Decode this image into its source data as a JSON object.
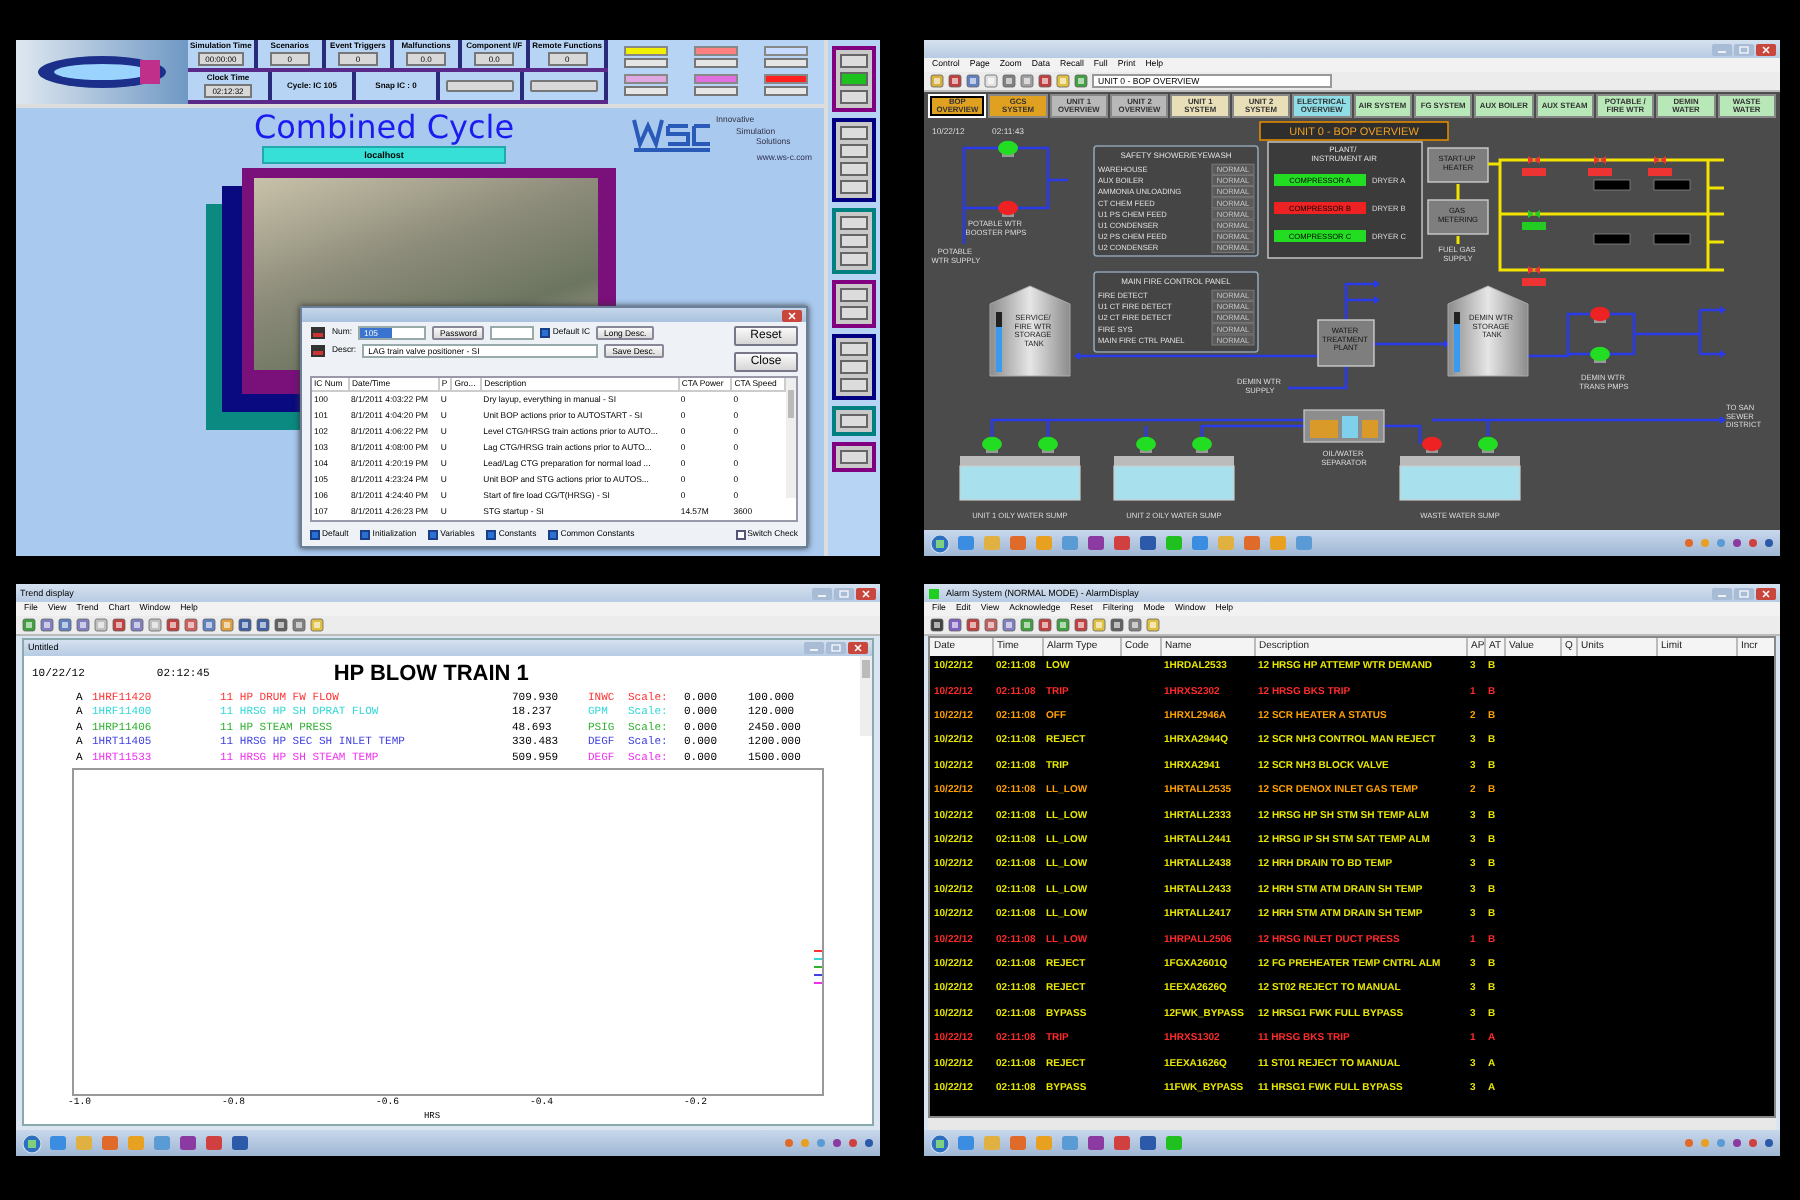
{
  "simulator": {
    "status_fields": [
      {
        "label": "Simulation Time",
        "value": "00:00:00"
      },
      {
        "label": "Scenarios",
        "value": "0"
      },
      {
        "label": "Event Triggers",
        "value": "0"
      },
      {
        "label": "Malfunctions",
        "value": "0.0"
      },
      {
        "label": "Component I/F",
        "value": "0.0"
      },
      {
        "label": "Remote Functions",
        "value": "0"
      }
    ],
    "info_fields": [
      {
        "label": "Clock Time",
        "value": "02:12:32"
      },
      {
        "label": "Cycle: IC 105"
      },
      {
        "label": "Snap IC : 0"
      }
    ],
    "alarm_tags": [
      {
        "color": "#f0f000"
      },
      {
        "color": "#ff8080"
      },
      {
        "color": "#c8dcff"
      },
      {
        "color": "#e0a8e0"
      },
      {
        "color": "#e070e0"
      },
      {
        "color": "#ff2020"
      }
    ],
    "title": "Combined Cycle",
    "server": "localhost",
    "brand_lines": [
      "Innovative",
      "Simulation",
      "Solutions"
    ],
    "website": "www.ws-c.com",
    "side_groups": [
      {
        "color": "#800080",
        "buttons": [
          {
            "active": false
          },
          {
            "active": true
          },
          {
            "active": false
          }
        ]
      },
      {
        "color": "#000080",
        "buttons": [
          {
            "active": false
          },
          {
            "active": false
          },
          {
            "active": false
          },
          {
            "active": false
          }
        ]
      },
      {
        "color": "#008080",
        "buttons": [
          {
            "active": false
          },
          {
            "active": false
          },
          {
            "active": false
          }
        ]
      },
      {
        "color": "#800080",
        "buttons": [
          {
            "active": false
          },
          {
            "active": false
          }
        ]
      },
      {
        "color": "#000080",
        "buttons": [
          {
            "active": false
          },
          {
            "active": false
          },
          {
            "active": false
          }
        ]
      },
      {
        "color": "#008080",
        "buttons": [
          {
            "active": false
          }
        ]
      },
      {
        "color": "#800080",
        "buttons": [
          {
            "active": false
          }
        ]
      }
    ],
    "dialog": {
      "num_label": "Num:",
      "num_value": "105",
      "password_button": "Password",
      "default_ic": {
        "label": "Default IC",
        "checked": true
      },
      "long_desc_button": "Long Desc.",
      "reset_button": "Reset",
      "close_button": "Close",
      "descr_label": "Descr:",
      "descr_value": "LAG train valve positioner - SI",
      "save_desc_button": "Save Desc.",
      "columns": [
        "IC Num",
        "Date/Time",
        "P",
        "Gro...",
        "Description",
        "CTA Power",
        "CTA Speed"
      ],
      "rows": [
        {
          "ic": "100",
          "datetime": "8/1/2011 4:03:22 PM",
          "p": "U",
          "description": "Dry layup, everything in manual - SI",
          "power": "0",
          "speed": "0"
        },
        {
          "ic": "101",
          "datetime": "8/1/2011 4:04:20 PM",
          "p": "U",
          "description": "Unit BOP actions prior to AUTOSTART - SI",
          "power": "0",
          "speed": "0"
        },
        {
          "ic": "102",
          "datetime": "8/1/2011 4:06:22 PM",
          "p": "U",
          "description": "Level CTG/HRSG train actions prior to AUTO...",
          "power": "0",
          "speed": "0"
        },
        {
          "ic": "103",
          "datetime": "8/1/2011 4:08:00 PM",
          "p": "U",
          "description": "Lag CTG/HRSG train actions prior to AUTO...",
          "power": "0",
          "speed": "0"
        },
        {
          "ic": "104",
          "datetime": "8/1/2011 4:20:19 PM",
          "p": "U",
          "description": "Lead/Lag CTG preparation for normal load ...",
          "power": "0",
          "speed": "0"
        },
        {
          "ic": "105",
          "datetime": "8/1/2011 4:23:24 PM",
          "p": "U",
          "description": "Unit BOP and STG actions prior to AUTOS...",
          "power": "0",
          "speed": "0"
        },
        {
          "ic": "106",
          "datetime": "8/1/2011 4:24:40 PM",
          "p": "U",
          "description": "Start of fire load CG/T(HRSG) - SI",
          "power": "0",
          "speed": "0"
        },
        {
          "ic": "107",
          "datetime": "8/1/2011 4:26:23 PM",
          "p": "U",
          "description": "STG startup - SI",
          "power": "14.57M",
          "speed": "3600"
        }
      ],
      "filters": [
        {
          "label": "Default",
          "checked": true
        },
        {
          "label": "Initialization",
          "checked": true
        },
        {
          "label": "Variables",
          "checked": true
        },
        {
          "label": "Constants",
          "checked": true
        },
        {
          "label": "Common Constants",
          "checked": true
        },
        {
          "label": "Switch Check",
          "checked": false
        }
      ]
    }
  },
  "bop": {
    "menu": [
      "Control",
      "Page",
      "Zoom",
      "Data",
      "Recall",
      "Full",
      "Print",
      "Help"
    ],
    "page_field": "UNIT 0 - BOP OVERVIEW",
    "tabs": [
      {
        "label": "BOP OVERVIEW",
        "color": "#e0a020",
        "selected": true
      },
      {
        "label": "GCS SYSTEM",
        "color": "#e0a020",
        "selected": false
      },
      {
        "label": "UNIT 1 OVERVIEW",
        "color": "#b8b8b8",
        "selected": false
      },
      {
        "label": "UNIT 2 OVERVIEW",
        "color": "#b8b8b8",
        "selected": false
      },
      {
        "label": "UNIT 1 SYSTEM",
        "color": "#e8dfb8",
        "selected": false
      },
      {
        "label": "UNIT 2 SYSTEM",
        "color": "#e8dfb8",
        "selected": false
      },
      {
        "label": "ELECTRICAL OVERVIEW",
        "color": "#8fdde6",
        "selected": false
      },
      {
        "label": "AIR SYSTEM",
        "color": "#b8e8b8",
        "selected": false
      },
      {
        "label": "FG SYSTEM",
        "color": "#b8e8b8",
        "selected": false
      },
      {
        "label": "AUX BOILER",
        "color": "#b8e8b8",
        "selected": false
      },
      {
        "label": "AUX STEAM",
        "color": "#b8e8b8",
        "selected": false
      },
      {
        "label": "POTABLE / FIRE WTR",
        "color": "#b8e8b8",
        "selected": false
      },
      {
        "label": "DEMIN WATER",
        "color": "#b8e8b8",
        "selected": false
      },
      {
        "label": "WASTE WATER",
        "color": "#b8e8b8",
        "selected": false
      }
    ],
    "date": "10/22/12",
    "time": "02:11:43",
    "title": "UNIT 0 - BOP OVERVIEW",
    "safety_panel": {
      "title": "SAFETY SHOWER/EYEWASH",
      "items": [
        {
          "label": "WAREHOUSE",
          "status": "NORMAL"
        },
        {
          "label": "AUX BOILER",
          "status": "NORMAL"
        },
        {
          "label": "AMMONIA UNLOADING",
          "status": "NORMAL"
        },
        {
          "label": "CT CHEM FEED",
          "status": "NORMAL"
        },
        {
          "label": "U1 PS CHEM FEED",
          "status": "NORMAL"
        },
        {
          "label": "U1 CONDENSER",
          "status": "NORMAL"
        },
        {
          "label": "U2 PS CHEM FEED",
          "status": "NORMAL"
        },
        {
          "label": "U2 CONDENSER",
          "status": "NORMAL"
        }
      ]
    },
    "fire_panel": {
      "title": "MAIN FIRE CONTROL PANEL",
      "items": [
        {
          "label": "FIRE DETECT",
          "status": "NORMAL"
        },
        {
          "label": "U1 CT FIRE DETECT",
          "status": "NORMAL"
        },
        {
          "label": "U2 CT FIRE DETECT",
          "status": "NORMAL"
        },
        {
          "label": "FIRE SYS",
          "status": "NORMAL"
        },
        {
          "label": "MAIN FIRE CTRL PANEL",
          "status": "NORMAL"
        }
      ]
    },
    "air_panel": {
      "title": "PLANT/ INSTRUMENT AIR",
      "compressors": [
        {
          "label": "COMPRESSOR A",
          "running": true,
          "dryer": "DRYER A"
        },
        {
          "label": "COMPRESSOR B",
          "running": false,
          "dryer": "DRYER B"
        },
        {
          "label": "COMPRESSOR C",
          "running": true,
          "dryer": "DRYER C"
        }
      ]
    },
    "potable": {
      "pump_label": "POTABLE WTR BOOSTER PMPS",
      "supply_label": "POTABLE WTR SUPPLY",
      "pumps": [
        {
          "running": true
        },
        {
          "running": false
        }
      ]
    },
    "service_tank": {
      "label": "SERVICE/ FIRE WTR STORAGE TANK",
      "level": 0.75
    },
    "water_plant": "WATER TREATMENT PLANT",
    "demin_supply": "DEMIN WTR SUPPLY",
    "demin_tank": {
      "label": "DEMIN WTR STORAGE TANK",
      "level": 0.8
    },
    "demin_pumps": {
      "label": "DEMIN WTR TRANS PMPS",
      "pumps": [
        {
          "running": false
        },
        {
          "running": true
        }
      ]
    },
    "heater": "START-UP HEATER",
    "metering": "GAS METERING",
    "fuel_supply": "FUEL GAS SUPPLY",
    "separator": "OIL/WATER SEPARATOR",
    "sewer": "TO SAN SEWER DISTRICT",
    "sumps": [
      {
        "label": "UNIT 1 OILY WATER SUMP",
        "pumps": [
          {
            "running": true
          },
          {
            "running": true
          }
        ]
      },
      {
        "label": "UNIT 2 OILY WATER SUMP",
        "pumps": [
          {
            "running": true
          },
          {
            "running": true
          }
        ]
      },
      {
        "label": "WASTE WATER SUMP",
        "pumps": [
          {
            "running": false
          },
          {
            "running": true
          }
        ]
      }
    ]
  },
  "trend": {
    "window_title": "Trend display",
    "menu": [
      "File",
      "View",
      "Trend",
      "Chart",
      "Window",
      "Help"
    ],
    "document_title": "Untitled",
    "date": "10/22/12",
    "time": "02:12:45",
    "title": "HP BLOW TRAIN 1",
    "pens": [
      {
        "marker": "A",
        "tag": "1HRF11420",
        "description": "11 HP DRUM FW FLOW",
        "value": "709.930",
        "unit": "INWC",
        "scale_label": "Scale:",
        "min": "0.000",
        "max": "100.000",
        "color": "#ff3030"
      },
      {
        "marker": "A",
        "tag": "1HRF11400",
        "description": "11 HRSG HP SH DPRAT FLOW",
        "value": "18.237",
        "unit": "GPM",
        "scale_label": "Scale:",
        "min": "0.000",
        "max": "120.000",
        "color": "#30d8d8"
      },
      {
        "marker": "A",
        "tag": "1HRP11406",
        "description": "11 HP STEAM PRESS",
        "value": "48.693",
        "unit": "PSIG",
        "scale_label": "Scale:",
        "min": "0.000",
        "max": "2450.000",
        "color": "#30b030"
      },
      {
        "marker": "A",
        "tag": "1HRT11405",
        "description": "11 HRSG HP SEC SH INLET TEMP",
        "value": "330.483",
        "unit": "DEGF",
        "scale_label": "Scale:",
        "min": "0.000",
        "max": "1200.000",
        "color": "#4040e0"
      },
      {
        "marker": "A",
        "tag": "1HRT11533",
        "description": "11 HRSG HP SH STEAM TEMP",
        "value": "509.959",
        "unit": "DEGF",
        "scale_label": "Scale:",
        "min": "0.000",
        "max": "1500.000",
        "color": "#f030f0"
      }
    ],
    "x_ticks": [
      "-1.0",
      "-0.8",
      "-0.6",
      "-0.4",
      "-0.2"
    ],
    "x_unit": "HRS"
  },
  "alarms": {
    "window_title": "Alarm System (NORMAL MODE) - AlarmDisplay",
    "menu": [
      "File",
      "Edit",
      "View",
      "Acknowledge",
      "Reset",
      "Filtering",
      "Mode",
      "Window",
      "Help"
    ],
    "columns": [
      "Date",
      "Time",
      "Alarm Type",
      "Code",
      "Name",
      "Description",
      "AP",
      "AT",
      "Value",
      "Q",
      "Units",
      "Limit",
      "Incr"
    ],
    "rows": [
      {
        "date": "10/22/12",
        "time": "02:11:08",
        "type": "LOW",
        "name": "1HRDAL2533",
        "description": "12 HRSG HP ATTEMP WTR DEMAND",
        "ap": "3",
        "at": "B",
        "color": "#e6e600"
      },
      {
        "date": "10/22/12",
        "time": "02:11:08",
        "type": "TRIP",
        "name": "1HRXS2302",
        "description": "12 HRSG BKS TRIP",
        "ap": "1",
        "at": "B",
        "color": "#ff2a2a"
      },
      {
        "date": "10/22/12",
        "time": "02:11:08",
        "type": "OFF",
        "name": "1HRXL2946A",
        "description": "12 SCR HEATER A STATUS",
        "ap": "2",
        "at": "B",
        "color": "#ffa000"
      },
      {
        "date": "10/22/12",
        "time": "02:11:08",
        "type": "REJECT",
        "name": "1HRXA2944Q",
        "description": "12 SCR NH3 CONTROL MAN REJECT",
        "ap": "3",
        "at": "B",
        "color": "#e6e600"
      },
      {
        "date": "10/22/12",
        "time": "02:11:08",
        "type": "TRIP",
        "name": "1HRXA2941",
        "description": "12 SCR NH3 BLOCK VALVE",
        "ap": "3",
        "at": "B",
        "color": "#e6e600"
      },
      {
        "date": "10/22/12",
        "time": "02:11:08",
        "type": "LL_LOW",
        "name": "1HRTALL2535",
        "description": "12 SCR DENOX INLET GAS TEMP",
        "ap": "2",
        "at": "B",
        "color": "#ffa000"
      },
      {
        "date": "10/22/12",
        "time": "02:11:08",
        "type": "LL_LOW",
        "name": "1HRTALL2333",
        "description": "12 HRSG HP SH STM SH TEMP ALM",
        "ap": "3",
        "at": "B",
        "color": "#e6e600"
      },
      {
        "date": "10/22/12",
        "time": "02:11:08",
        "type": "LL_LOW",
        "name": "1HRTALL2441",
        "description": "12 HRSG IP SH STM SAT TEMP ALM",
        "ap": "3",
        "at": "B",
        "color": "#e6e600"
      },
      {
        "date": "10/22/12",
        "time": "02:11:08",
        "type": "LL_LOW",
        "name": "1HRTALL2438",
        "description": "12 HRH DRAIN TO BD TEMP",
        "ap": "3",
        "at": "B",
        "color": "#e6e600"
      },
      {
        "date": "10/22/12",
        "time": "02:11:08",
        "type": "LL_LOW",
        "name": "1HRTALL2433",
        "description": "12 HRH STM ATM DRAIN SH TEMP",
        "ap": "3",
        "at": "B",
        "color": "#e6e600"
      },
      {
        "date": "10/22/12",
        "time": "02:11:08",
        "type": "LL_LOW",
        "name": "1HRTALL2417",
        "description": "12 HRH STM ATM DRAIN SH TEMP",
        "ap": "3",
        "at": "B",
        "color": "#e6e600"
      },
      {
        "date": "10/22/12",
        "time": "02:11:08",
        "type": "LL_LOW",
        "name": "1HRPALL2506",
        "description": "12 HRSG INLET DUCT PRESS",
        "ap": "1",
        "at": "B",
        "color": "#ff2a2a"
      },
      {
        "date": "10/22/12",
        "time": "02:11:08",
        "type": "REJECT",
        "name": "1FGXA2601Q",
        "description": "12 FG PREHEATER TEMP CNTRL ALM",
        "ap": "3",
        "at": "B",
        "color": "#e6e600"
      },
      {
        "date": "10/22/12",
        "time": "02:11:08",
        "type": "REJECT",
        "name": "1EEXA2626Q",
        "description": "12 ST02 REJECT TO MANUAL",
        "ap": "3",
        "at": "B",
        "color": "#e6e600"
      },
      {
        "date": "10/22/12",
        "time": "02:11:08",
        "type": "BYPASS",
        "name": "12FWK_BYPASS",
        "description": "12 HRSG1 FWK FULL BYPASS",
        "ap": "3",
        "at": "B",
        "color": "#e6e600"
      },
      {
        "date": "10/22/12",
        "time": "02:11:08",
        "type": "TRIP",
        "name": "1HRXS1302",
        "description": "11 HRSG BKS TRIP",
        "ap": "1",
        "at": "A",
        "color": "#ff2a2a"
      },
      {
        "date": "10/22/12",
        "time": "02:11:08",
        "type": "REJECT",
        "name": "1EEXA1626Q",
        "description": "11 ST01 REJECT TO MANUAL",
        "ap": "3",
        "at": "A",
        "color": "#e6e600"
      },
      {
        "date": "10/22/12",
        "time": "02:11:08",
        "type": "BYPASS",
        "name": "11FWK_BYPASS",
        "description": "11 HRSG1 FWK FULL BYPASS",
        "ap": "3",
        "at": "A",
        "color": "#e6e600"
      }
    ]
  }
}
